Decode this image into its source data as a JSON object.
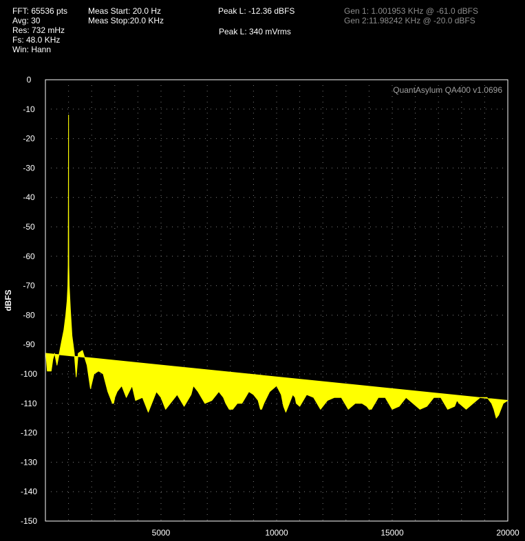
{
  "info": {
    "fft": "FFT: 65536 pts",
    "avg": "Avg: 30",
    "res": "Res: 732 mHz",
    "fs": "Fs: 48.0 KHz",
    "win": "Win: Hann",
    "meas_start": "Meas Start: 20.0 Hz",
    "meas_stop": "Meas Stop:20.0 KHz",
    "peak_level": "Peak L: -12.36 dBFS",
    "peak_rms": "Peak L: 340 mVrms",
    "gen1": "Gen 1: 1.001953 KHz @ -61.0  dBFS",
    "gen2": "Gen 2:11.98242 KHz @ -20.0  dBFS"
  },
  "colors": {
    "background": "#000000",
    "trace": "#ffff00",
    "axis": "#ffffff",
    "grid": "#808080",
    "watermark": "#a0a0a0"
  },
  "chart_data": {
    "type": "area",
    "watermark": "QuantAsylum QA400 v1.0696",
    "ylabel": "dBFS",
    "xlabel": "",
    "xlim": [
      0,
      20000
    ],
    "ylim": [
      -150,
      0
    ],
    "xticks": [
      5000,
      10000,
      15000,
      20000
    ],
    "yticks": [
      0,
      -10,
      -20,
      -30,
      -40,
      -50,
      -60,
      -70,
      -80,
      -90,
      -100,
      -110,
      -120,
      -130,
      -140,
      -150
    ],
    "grid": true,
    "series": [
      {
        "x": [
          20,
          80,
          160,
          250,
          320,
          400,
          500,
          600,
          700,
          800,
          880,
          940,
          970,
          985,
          993,
          1000,
          1002,
          1004,
          1012,
          1030,
          1080,
          1150,
          1250,
          1330,
          1420,
          1600,
          1800,
          1950,
          2100,
          2300,
          2500,
          2700,
          2900,
          2950,
          3000,
          3100,
          3300,
          3500,
          3750,
          3900,
          4200,
          4300,
          4450,
          4800,
          5000,
          5200,
          5400,
          5700,
          6000,
          6300,
          6400,
          6600,
          6900,
          7200,
          7500,
          7700,
          7800,
          7950,
          8100,
          8300,
          8500,
          8800,
          9000,
          9200,
          9300,
          9350,
          9450,
          9700,
          10000,
          10200,
          10300,
          10400,
          10550,
          10700,
          10800,
          10850,
          11000,
          11300,
          11600,
          11900,
          12200,
          12500,
          12800,
          13100,
          13400,
          13700,
          13900,
          14000,
          14100,
          14400,
          14700,
          15000,
          15300,
          15600,
          15900,
          16200,
          16500,
          16800,
          17100,
          17400,
          17700,
          17800,
          17900,
          18200,
          18500,
          18800,
          19100,
          19300,
          19400,
          19500,
          19600,
          19800,
          20000
        ],
        "upper": [
          -93,
          -99,
          -99,
          -99,
          -95,
          -93,
          -97,
          -93,
          -89,
          -85,
          -80,
          -75,
          -70,
          -63,
          -40,
          -12,
          -12,
          -40,
          -63,
          -70,
          -78,
          -87,
          -93,
          -101,
          -93,
          -92,
          -97,
          -105,
          -100,
          -99,
          -100,
          -106,
          -110,
          -110,
          -108,
          -106,
          -104,
          -108,
          -104,
          -109,
          -108,
          -110,
          -113,
          -106,
          -108,
          -112,
          -110,
          -107,
          -111,
          -107,
          -104,
          -106,
          -110,
          -109,
          -106,
          -108,
          -110,
          -112,
          -112,
          -110,
          -110,
          -106,
          -107,
          -109,
          -112,
          -112,
          -110,
          -106,
          -104,
          -107,
          -111,
          -113,
          -110,
          -107,
          -108,
          -110,
          -111,
          -107,
          -108,
          -112,
          -109,
          -108,
          -108,
          -112,
          -110,
          -110,
          -111,
          -112,
          -112,
          -108,
          -108,
          -112,
          -111,
          -108,
          -110,
          -112,
          -111,
          -108,
          -108,
          -112,
          -111,
          -109,
          -110,
          -112,
          -110,
          -108,
          -108,
          -110,
          -112,
          -115,
          -114,
          -110,
          -109
        ],
        "lower": [
          -103,
          -130,
          -100,
          -110,
          -105,
          -101,
          -99,
          -109,
          -99,
          -102,
          -93,
          -88,
          -75,
          -65,
          -45,
          -13,
          -13,
          -45,
          -65,
          -80,
          -90,
          -101,
          -111,
          -107,
          -100,
          -101,
          -106,
          -115,
          -107,
          -104,
          -106,
          -113,
          -128,
          -126,
          -113,
          -110,
          -110,
          -114,
          -110,
          -118,
          -113,
          -113,
          -120,
          -112,
          -114,
          -120,
          -116,
          -114,
          -122,
          -118,
          -112,
          -114,
          -118,
          -119,
          -114,
          -118,
          -125,
          -147,
          -125,
          -118,
          -120,
          -114,
          -115,
          -120,
          -125,
          -134,
          -125,
          -115,
          -113,
          -120,
          -132,
          -142,
          -130,
          -120,
          -122,
          -140,
          -130,
          -120,
          -125,
          -133,
          -123,
          -120,
          -123,
          -133,
          -125,
          -125,
          -130,
          -145,
          -130,
          -122,
          -122,
          -133,
          -128,
          -122,
          -125,
          -135,
          -130,
          -123,
          -123,
          -140,
          -130,
          -125,
          -128,
          -146,
          -145,
          -130,
          -120,
          -118,
          -115
        ]
      }
    ]
  }
}
